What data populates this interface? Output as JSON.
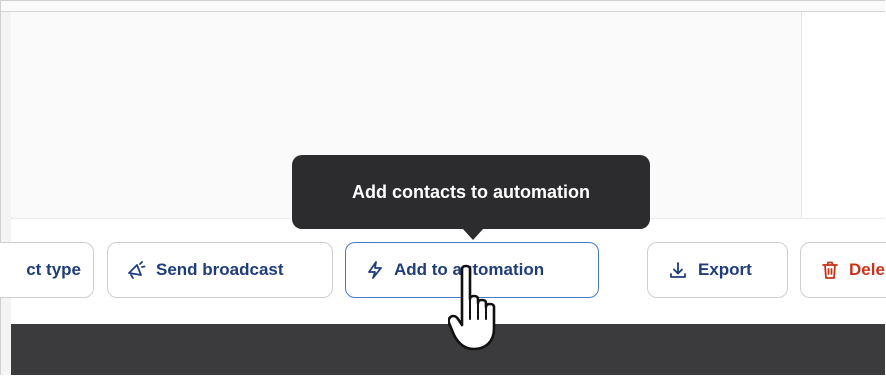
{
  "toolbar": {
    "buttons": [
      {
        "label": "ct type",
        "icon": "none"
      },
      {
        "label": "Send broadcast",
        "icon": "megaphone-icon"
      },
      {
        "label": "Add to automation",
        "icon": "lightning-icon"
      },
      {
        "label": "Export",
        "icon": "download-icon"
      },
      {
        "label": "Dele",
        "icon": "trash-icon"
      }
    ]
  },
  "tooltip": {
    "text": "Add contacts to automation"
  },
  "colors": {
    "button_text": "#1f3d7a",
    "delete_text": "#c8341b",
    "tooltip_bg": "#2c2c2e",
    "active_border": "#4a78c9",
    "bottom_bar": "#3b3b3e"
  }
}
